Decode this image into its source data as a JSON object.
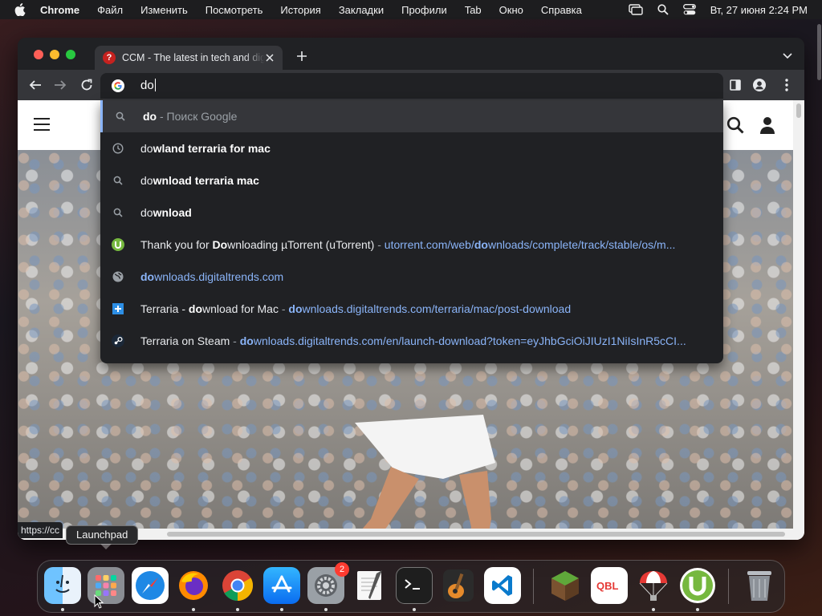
{
  "menubar": {
    "app_name": "Chrome",
    "items": [
      "Файл",
      "Изменить",
      "Посмотреть",
      "История",
      "Закладки",
      "Профили",
      "Tab",
      "Окно",
      "Справка"
    ],
    "clock": "Вт, 27 июня  2:24 PM"
  },
  "browser": {
    "tab_title": "CCM - The latest in tech and digital",
    "tab_favicon_text": "?",
    "omnibox_value": "do"
  },
  "suggestions": [
    {
      "icon": "search-icon",
      "match": "do",
      "rest": "",
      "suffix": " - Поиск Google"
    },
    {
      "icon": "history-clock-icon",
      "match": "do",
      "rest": "wland terraria for mac"
    },
    {
      "icon": "search-icon",
      "match": "do",
      "rest": "wnload terraria mac"
    },
    {
      "icon": "search-icon",
      "match": "do",
      "rest": "wnload"
    },
    {
      "icon": "utorrent-favicon-icon",
      "title_pre": "Thank you for ",
      "title_match": "Do",
      "title_post": "wnloading µTorrent (uTorrent)",
      "url_pre": "utorrent.com/web/",
      "url_match": "do",
      "url_post": "wnloads/complete/track/stable/os/m..."
    },
    {
      "icon": "globe-icon",
      "url_match": "do",
      "url_post": "wnloads.digitaltrends.com"
    },
    {
      "icon": "digitaltrends-favicon-icon",
      "title_pre": "Terraria - ",
      "title_match": "do",
      "title_post": "wnload for Mac",
      "url_match": "do",
      "url_post": "wnloads.digitaltrends.com/terraria/mac/post-download"
    },
    {
      "icon": "steam-favicon-icon",
      "title_pre": "Terraria on Steam",
      "url_match": "do",
      "url_post": "wnloads.digitaltrends.com/en/launch-download?token=eyJhbGciOiJIUzI1NiIsInR5cCI..."
    }
  ],
  "page": {
    "status_url": "https://cc"
  },
  "dock": {
    "tooltip": "Launchpad",
    "settings_badge": "2",
    "apps": [
      "Finder",
      "Launchpad",
      "Safari",
      "Firefox",
      "Chrome",
      "App Store",
      "System Settings",
      "TextEdit",
      "Terminal",
      "GarageBand",
      "Visual Studio Code",
      "Minecraft",
      "QBL",
      "Parachute",
      "uTorrent",
      "Trash"
    ]
  },
  "colors": {
    "accent_link": "#8ab4f8",
    "badge_red": "#ff3b30",
    "tab_favicon": "#c5221f"
  }
}
